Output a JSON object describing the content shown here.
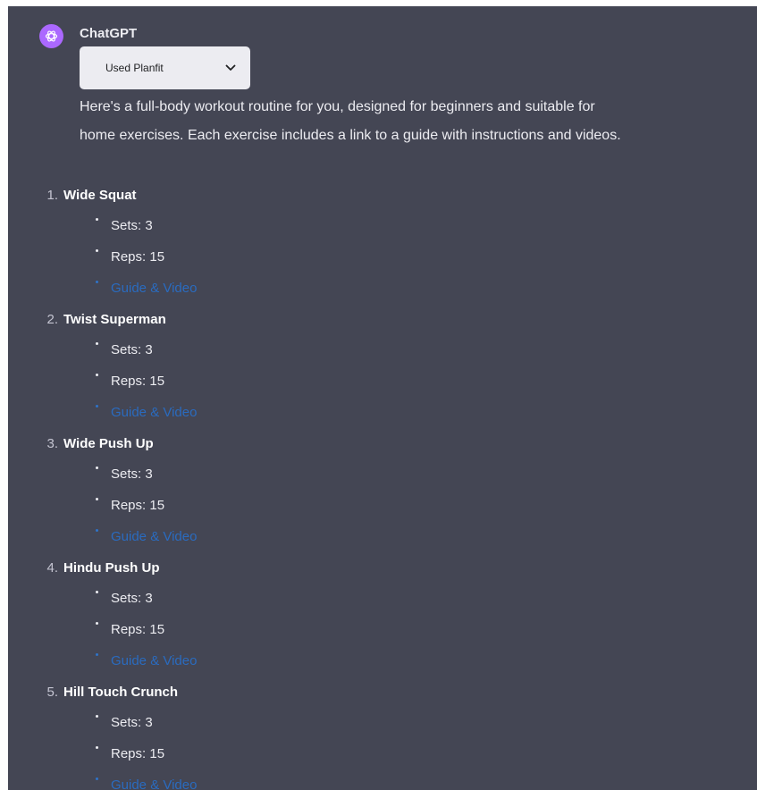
{
  "message": {
    "author": "ChatGPT",
    "avatar_icon": "openai-logo-icon",
    "avatar_color": "#ab68ff",
    "plugin_status": "Used Planfit",
    "intro_line_1": "Here's a full-body workout routine for you, designed for beginners and suitable for",
    "intro_line_2": "home exercises. Each exercise includes a link to a guide with instructions and videos."
  },
  "exercises": [
    {
      "number": "1.",
      "name": "Wide Squat",
      "sets": "Sets: 3",
      "reps": "Reps: 15",
      "link": "Guide & Video"
    },
    {
      "number": "2.",
      "name": "Twist Superman",
      "sets": "Sets: 3",
      "reps": "Reps: 15",
      "link": "Guide & Video"
    },
    {
      "number": "3.",
      "name": "Wide Push Up",
      "sets": "Sets: 3",
      "reps": "Reps: 15",
      "link": "Guide & Video"
    },
    {
      "number": "4.",
      "name": "Hindu Push Up",
      "sets": "Sets: 3",
      "reps": "Reps: 15",
      "link": "Guide & Video"
    },
    {
      "number": "5.",
      "name": "Hill Touch Crunch",
      "sets": "Sets: 3",
      "reps": "Reps: 15",
      "link": "Guide & Video"
    }
  ],
  "colors": {
    "panel_background": "#444654",
    "link": "#2a6bbf",
    "plugin_pill": "#ececf1"
  }
}
